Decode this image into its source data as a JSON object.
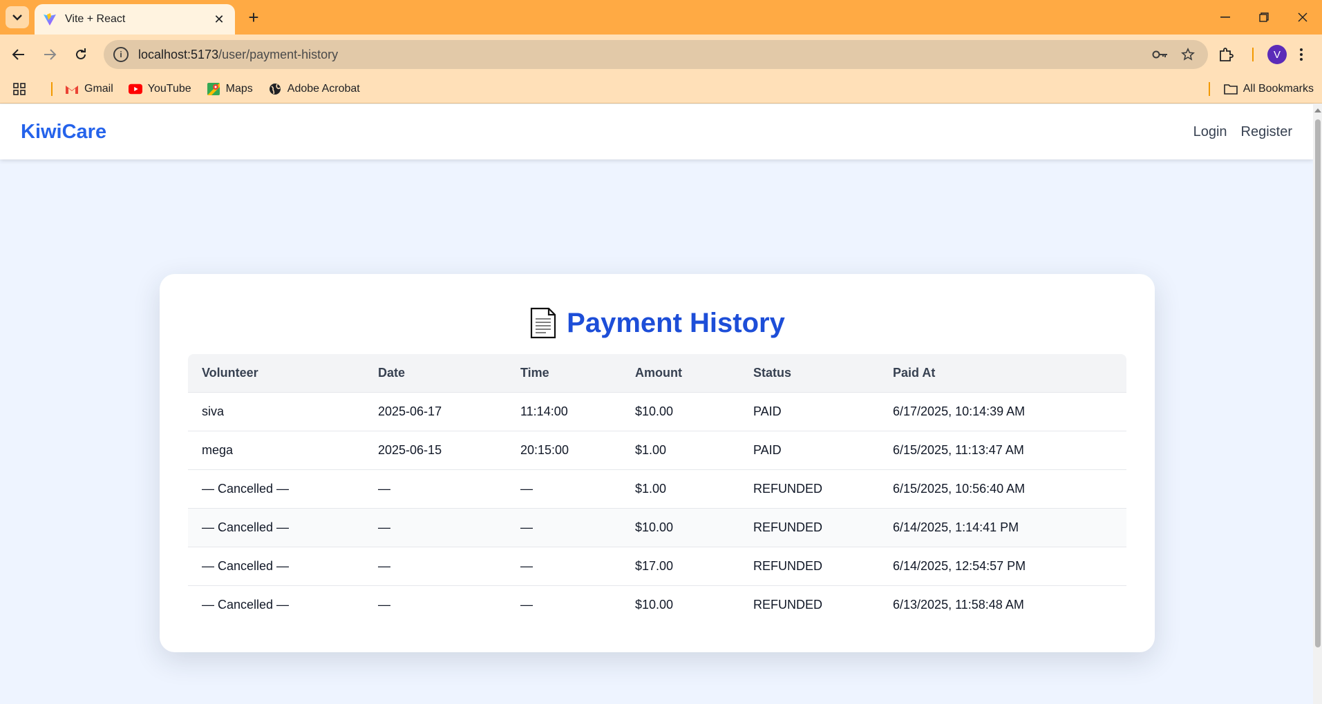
{
  "browser": {
    "tab_title": "Vite + React",
    "url_host": "localhost:5173",
    "url_path": "/user/payment-history",
    "bookmarks": [
      "Gmail",
      "YouTube",
      "Maps",
      "Adobe Acrobat"
    ],
    "all_bookmarks": "All Bookmarks",
    "profile_initial": "V"
  },
  "navbar": {
    "brand": "KiwiCare",
    "login": "Login",
    "register": "Register"
  },
  "card": {
    "title": "Payment History"
  },
  "table": {
    "headers": [
      "Volunteer",
      "Date",
      "Time",
      "Amount",
      "Status",
      "Paid At"
    ],
    "rows": [
      [
        "siva",
        "2025-06-17",
        "11:14:00",
        "$10.00",
        "PAID",
        "6/17/2025, 10:14:39 AM"
      ],
      [
        "mega",
        "2025-06-15",
        "20:15:00",
        "$1.00",
        "PAID",
        "6/15/2025, 11:13:47 AM"
      ],
      [
        "— Cancelled —",
        "—",
        "—",
        "$1.00",
        "REFUNDED",
        "6/15/2025, 10:56:40 AM"
      ],
      [
        "— Cancelled —",
        "—",
        "—",
        "$10.00",
        "REFUNDED",
        "6/14/2025, 1:14:41 PM"
      ],
      [
        "— Cancelled —",
        "—",
        "—",
        "$17.00",
        "REFUNDED",
        "6/14/2025, 12:54:57 PM"
      ],
      [
        "— Cancelled —",
        "—",
        "—",
        "$10.00",
        "REFUNDED",
        "6/13/2025, 11:58:48 AM"
      ]
    ]
  },
  "colors": {
    "accent": "#2563eb",
    "title": "#1d4ed8",
    "page_bg": "#eef4ff",
    "tabstrip": "#ffaa44"
  }
}
